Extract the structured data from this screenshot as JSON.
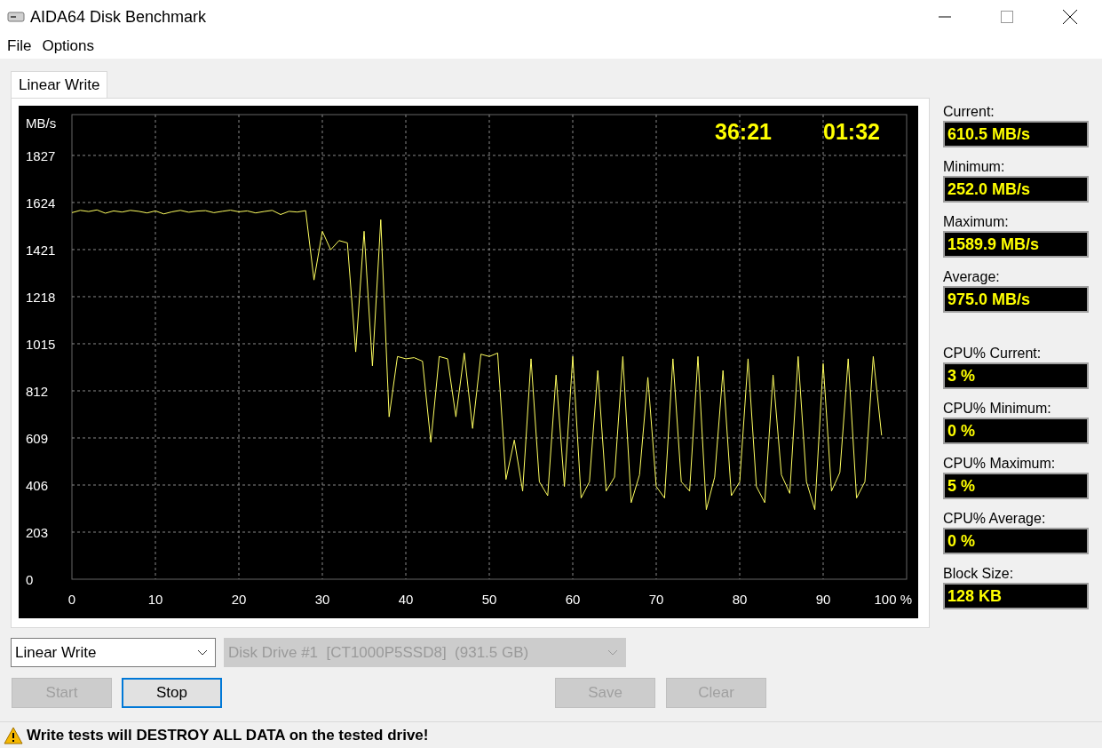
{
  "window": {
    "title": "AIDA64 Disk Benchmark"
  },
  "menu": [
    "File",
    "Options"
  ],
  "tabs": [
    {
      "label": "Linear Write",
      "selected": true
    }
  ],
  "graph": {
    "timers": [
      "36:21",
      "01:32"
    ],
    "chart_data": {
      "type": "line",
      "ylabel": "MB/s",
      "grid": true,
      "xlim": [
        0,
        100
      ],
      "ylim": [
        0,
        2003
      ],
      "yticks": [
        {
          "value": 1827,
          "label": "1827"
        },
        {
          "value": 1624,
          "label": "1624"
        },
        {
          "value": 1421,
          "label": "1421"
        },
        {
          "value": 1218,
          "label": "1218"
        },
        {
          "value": 1015,
          "label": "1015"
        },
        {
          "value": 812,
          "label": "812"
        },
        {
          "value": 609,
          "label": "609"
        },
        {
          "value": 406,
          "label": "406"
        },
        {
          "value": 203,
          "label": "203"
        },
        {
          "value": 0,
          "label": "0"
        }
      ],
      "xticks": [
        {
          "value": 0,
          "label": "0"
        },
        {
          "value": 10,
          "label": "10"
        },
        {
          "value": 20,
          "label": "20"
        },
        {
          "value": 30,
          "label": "30"
        },
        {
          "value": 40,
          "label": "40"
        },
        {
          "value": 50,
          "label": "50"
        },
        {
          "value": 60,
          "label": "60"
        },
        {
          "value": 70,
          "label": "70"
        },
        {
          "value": 80,
          "label": "80"
        },
        {
          "value": 90,
          "label": "90"
        },
        {
          "value": 100,
          "label": "100 %"
        }
      ],
      "x": [
        0,
        1,
        2,
        3,
        4,
        5,
        6,
        7,
        8,
        9,
        10,
        11,
        12,
        13,
        14,
        15,
        16,
        17,
        18,
        19,
        20,
        21,
        22,
        23,
        24,
        25,
        26,
        27,
        28,
        29,
        30,
        31,
        32,
        33,
        34,
        35,
        36,
        37,
        38,
        39,
        40,
        41,
        42,
        43,
        44,
        45,
        46,
        47,
        48,
        49,
        50,
        51,
        52,
        53,
        54,
        55,
        56,
        57,
        58,
        59,
        60,
        61,
        62,
        63,
        64,
        65,
        66,
        67,
        68,
        69,
        70,
        71,
        72,
        73,
        74,
        75,
        76,
        77,
        78,
        79,
        80,
        81,
        82,
        83,
        84,
        85,
        86,
        87,
        88,
        89,
        90,
        91,
        92,
        93,
        94,
        95,
        96,
        97
      ],
      "series": [
        {
          "color": "#ffff60",
          "values": [
            1580,
            1590,
            1585,
            1592,
            1578,
            1588,
            1583,
            1590,
            1586,
            1579,
            1588,
            1575,
            1584,
            1590,
            1582,
            1587,
            1589,
            1580,
            1586,
            1591,
            1584,
            1588,
            1579,
            1585,
            1590,
            1572,
            1586,
            1583,
            1589,
            1290,
            1500,
            1420,
            1460,
            1450,
            980,
            1500,
            920,
            1550,
            700,
            960,
            950,
            955,
            940,
            590,
            960,
            950,
            700,
            975,
            650,
            970,
            960,
            975,
            430,
            600,
            380,
            950,
            420,
            360,
            880,
            400,
            960,
            350,
            420,
            900,
            380,
            440,
            960,
            330,
            450,
            870,
            400,
            350,
            950,
            420,
            380,
            960,
            300,
            440,
            900,
            360,
            420,
            950,
            400,
            330,
            880,
            450,
            370,
            960,
            420,
            300,
            930,
            380,
            460,
            950,
            350,
            420,
            960,
            620
          ]
        }
      ]
    }
  },
  "stats": [
    {
      "label": "Current:",
      "value": "610.5 MB/s"
    },
    {
      "label": "Minimum:",
      "value": "252.0 MB/s"
    },
    {
      "label": "Maximum:",
      "value": "1589.9 MB/s"
    },
    {
      "label": "Average:",
      "value": "975.0 MB/s"
    },
    {
      "label": "CPU% Current:",
      "value": "3 %"
    },
    {
      "label": "CPU% Minimum:",
      "value": "0 %"
    },
    {
      "label": "CPU% Maximum:",
      "value": "5 %"
    },
    {
      "label": "CPU% Average:",
      "value": "0 %"
    },
    {
      "label": "Block Size:",
      "value": "128 KB"
    }
  ],
  "test_select": {
    "value": "Linear Write",
    "disabled": false
  },
  "drive_select": {
    "value": "Disk Drive #1  [CT1000P5SSD8]  (931.5 GB)",
    "disabled": true
  },
  "buttons": [
    {
      "label": "Start",
      "disabled": true
    },
    {
      "label": "Stop",
      "disabled": false
    },
    {
      "label": "Save",
      "disabled": true
    },
    {
      "label": "Clear",
      "disabled": true
    }
  ],
  "status": "Write tests will DESTROY ALL DATA on the tested drive!"
}
